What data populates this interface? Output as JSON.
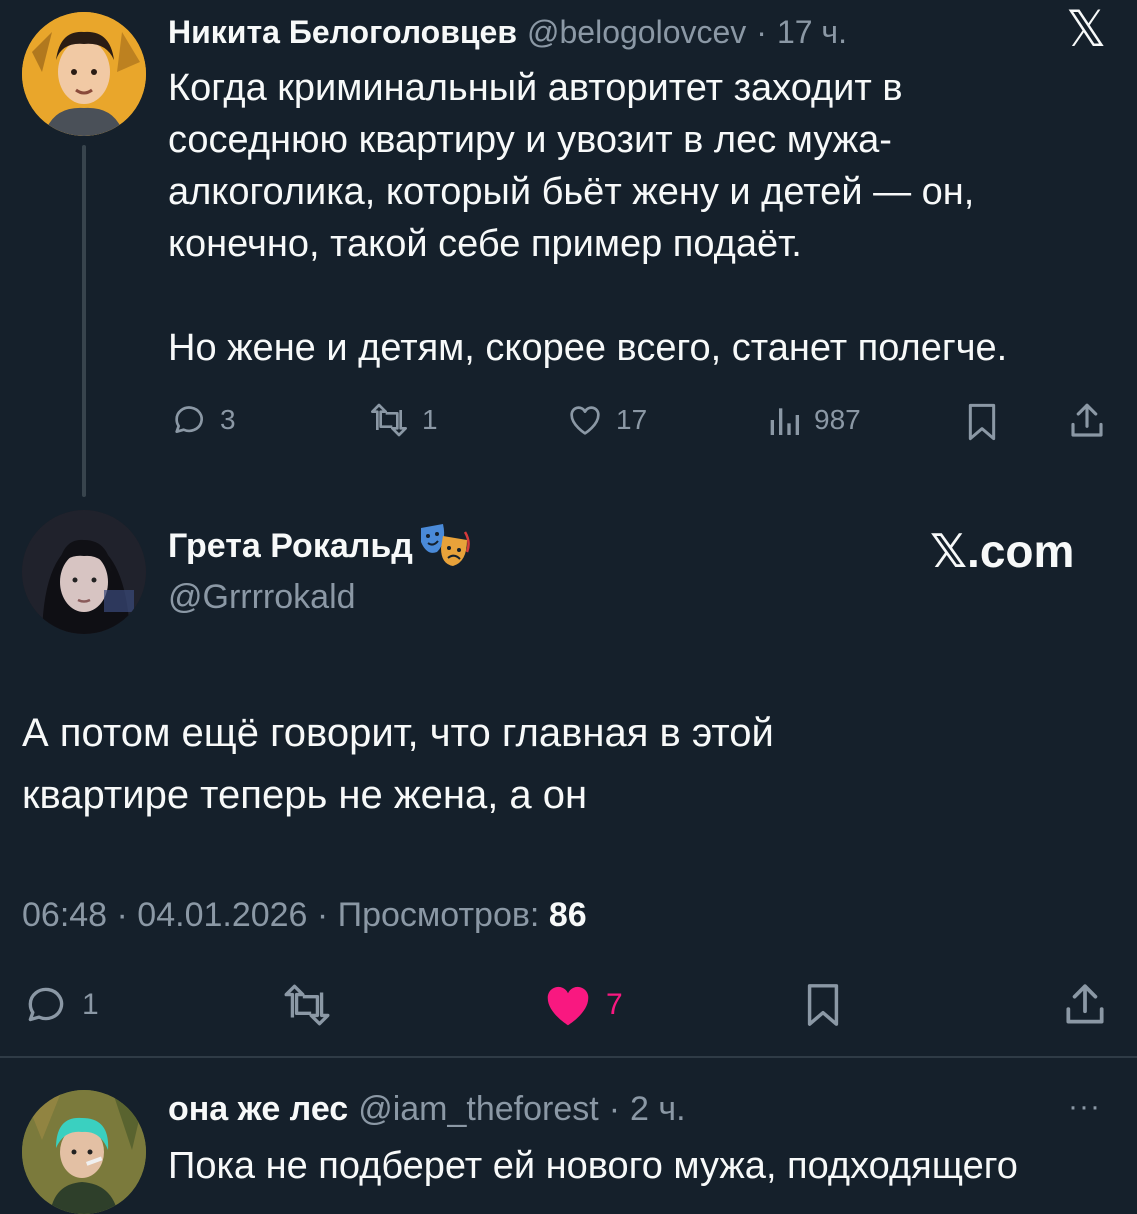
{
  "tweet1": {
    "author_name": "Никита Белоголовцев",
    "handle": "@belogolovcev",
    "separator": "·",
    "time": "17 ч.",
    "text": "Когда криминальный авторитет заходит в\nсоседнюю квартиру и увозит в лес мужа-\nалкоголика, который бьёт жену и детей — он,\nконечно, такой себе пример подаёт.\n\nНо жене и детям, скорее всего, станет полегче.",
    "replies": "3",
    "reposts": "1",
    "likes": "17",
    "views": "987"
  },
  "tweet2": {
    "author_name": "Грета Рокальд",
    "handle": "@Grrrrokald",
    "brand_watermark": "𝕏.com",
    "text": "А потом ещё говорит, что главная в этой\nквартире теперь не жена, а он",
    "timestamp": "06:48 · 04.01.2026 · Просмотров: ",
    "views": "86",
    "replies": "1",
    "likes": "7",
    "like_color": "#f91880"
  },
  "tweet3": {
    "author_name": "она же лес",
    "handle": "@iam_theforest",
    "separator": "·",
    "time": "2 ч.",
    "text": "Пока не подберет ей нового мужа, подходящего"
  },
  "icons": {
    "x_logo": "𝕏",
    "more": "···"
  },
  "colors": {
    "background": "#15202b",
    "text": "#f7f9f9",
    "muted": "#8b98a5",
    "like": "#f91880"
  }
}
